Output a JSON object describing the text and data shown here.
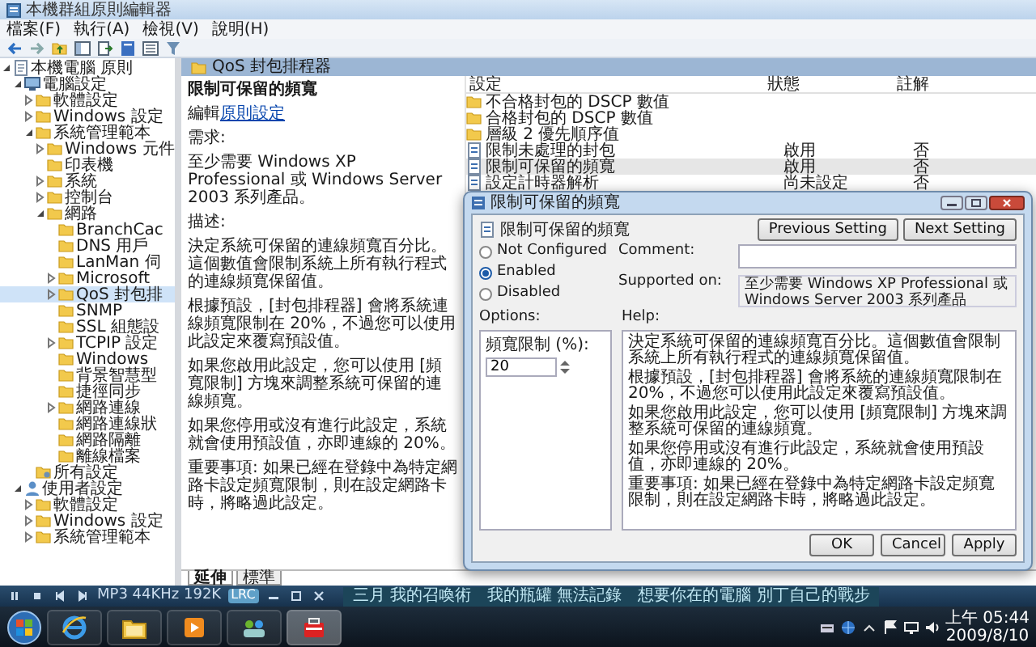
{
  "window": {
    "title": "本機群組原則編輯器"
  },
  "menu": [
    "檔案(F)",
    "執行(A)",
    "檢視(V)",
    "說明(H)"
  ],
  "tree": [
    {
      "label": "本機電腦 原則",
      "kind": "root",
      "expanded": true,
      "selected": false,
      "children": [
        {
          "label": "電腦設定",
          "kind": "computer",
          "expanded": true,
          "selected": false,
          "children": [
            {
              "label": "軟體設定",
              "kind": "folder",
              "expanded": false,
              "selected": false
            },
            {
              "label": "Windows 設定",
              "kind": "folder",
              "expanded": false,
              "selected": false
            },
            {
              "label": "系統管理範本",
              "kind": "folder",
              "expanded": true,
              "selected": false,
              "children": [
                {
                  "label": "Windows 元件",
                  "kind": "folder",
                  "expanded": false,
                  "selected": false
                },
                {
                  "label": "印表機",
                  "kind": "folder",
                  "selected": false
                },
                {
                  "label": "系統",
                  "kind": "folder",
                  "expanded": false,
                  "selected": false
                },
                {
                  "label": "控制台",
                  "kind": "folder",
                  "expanded": false,
                  "selected": false
                },
                {
                  "label": "網路",
                  "kind": "folder",
                  "expanded": true,
                  "selected": false,
                  "children": [
                    {
                      "label": "BranchCac",
                      "kind": "folder",
                      "selected": false
                    },
                    {
                      "label": "DNS 用戶",
                      "kind": "folder",
                      "selected": false
                    },
                    {
                      "label": "LanMan 伺",
                      "kind": "folder",
                      "selected": false
                    },
                    {
                      "label": "Microsoft",
                      "kind": "folder",
                      "expanded": false,
                      "selected": false
                    },
                    {
                      "label": "QoS 封包排",
                      "kind": "folder",
                      "expanded": false,
                      "selected": true
                    },
                    {
                      "label": "SNMP",
                      "kind": "folder",
                      "selected": false
                    },
                    {
                      "label": "SSL 組態設",
                      "kind": "folder",
                      "selected": false
                    },
                    {
                      "label": "TCPIP 設定",
                      "kind": "folder",
                      "expanded": false,
                      "selected": false
                    },
                    {
                      "label": "Windows",
                      "kind": "folder",
                      "selected": false
                    },
                    {
                      "label": "背景智慧型",
                      "kind": "folder",
                      "selected": false
                    },
                    {
                      "label": "捷徑同步",
                      "kind": "folder",
                      "selected": false
                    },
                    {
                      "label": "網路連線",
                      "kind": "folder",
                      "expanded": false,
                      "selected": false
                    },
                    {
                      "label": "網路連線狀",
                      "kind": "folder",
                      "selected": false
                    },
                    {
                      "label": "網路隔離",
                      "kind": "folder",
                      "selected": false
                    },
                    {
                      "label": "離線檔案",
                      "kind": "folder",
                      "selected": false
                    }
                  ]
                }
              ]
            },
            {
              "label": "所有設定",
              "kind": "settings",
              "selected": false
            }
          ]
        },
        {
          "label": "使用者設定",
          "kind": "user",
          "expanded": true,
          "selected": false,
          "children": [
            {
              "label": "軟體設定",
              "kind": "folder",
              "expanded": false,
              "selected": false
            },
            {
              "label": "Windows 設定",
              "kind": "folder",
              "expanded": false,
              "selected": false
            },
            {
              "label": "系統管理範本",
              "kind": "folder",
              "expanded": false,
              "selected": false
            }
          ]
        }
      ]
    }
  ],
  "header": {
    "title": "QoS 封包排程器"
  },
  "description": {
    "title": "限制可保留的頻寬",
    "edit_prefix": "編輯",
    "edit_link": "原則設定",
    "requirements_label": "需求:",
    "requirements": "至少需要 Windows XP Professional 或 Windows Server 2003 系列產品。",
    "description_label": "描述:",
    "paragraphs": [
      "決定系統可保留的連線頻寬百分比。這個數值會限制系統上所有執行程式的連線頻寬保留值。",
      "根據預設，[封包排程器] 會將系統連線頻寬限制在 20%，不過您可以使用此設定來覆寫預設值。",
      "如果您啟用此設定，您可以使用 [頻寬限制] 方塊來調整系統可保留的連線頻寬。",
      "如果您停用或沒有進行此設定，系統就會使用預設值，亦即連線的 20%。",
      "重要事項: 如果已經在登錄中為特定網路卡設定頻寬限制，則在設定網路卡時，將略過此設定。"
    ]
  },
  "list": {
    "columns": [
      "設定",
      "狀態",
      "註解"
    ],
    "rows": [
      {
        "kind": "folder",
        "name": "不合格封包的 DSCP 數值",
        "selected": false
      },
      {
        "kind": "folder",
        "name": "合格封包的 DSCP 數值",
        "selected": false
      },
      {
        "kind": "folder",
        "name": "層級 2 優先順序值",
        "selected": false
      },
      {
        "kind": "policy",
        "name": "限制未處理的封包",
        "state": "啟用",
        "comment": "否",
        "selected": false
      },
      {
        "kind": "policy",
        "name": "限制可保留的頻寬",
        "state": "啟用",
        "comment": "否",
        "selected": true
      },
      {
        "kind": "policy",
        "name": "設定計時器解析",
        "state": "尚未設定",
        "comment": "否",
        "selected": false
      }
    ]
  },
  "dialog": {
    "title": "限制可保留的頻寬",
    "heading": "限制可保留的頻寬",
    "nav_buttons": [
      "Previous Setting",
      "Next Setting"
    ],
    "radios": [
      {
        "label": "Not Configured",
        "selected": false
      },
      {
        "label": "Enabled",
        "selected": true
      },
      {
        "label": "Disabled",
        "selected": false
      }
    ],
    "comment_label": "Comment:",
    "supported_label": "Supported on:",
    "supported_text": "至少需要 Windows XP Professional 或 Windows Server 2003 系列產品",
    "options_label": "Options:",
    "help_label": "Help:",
    "option": {
      "label": "頻寬限制 (%):",
      "value": "20"
    },
    "help": [
      "決定系統可保留的連線頻寬百分比。這個數值會限制系統上所有執行程式的連線頻寬保留值。",
      "根據預設，[封包排程器] 會將系統的連線頻寬限制在 20%，不過您可以使用此設定來覆寫預設值。",
      "如果您啟用此設定，您可以使用 [頻寬限制] 方塊來調整系統可保留的連線頻寬。",
      "如果您停用或沒有進行此設定，系統就會使用預設值，亦即連線的 20%。",
      "重要事項: 如果已經在登錄中為特定網路卡設定頻寬限制，則在設定網路卡時，將略過此設定。"
    ],
    "buttons": [
      "OK",
      "Cancel",
      "Apply"
    ]
  },
  "view_tabs": [
    {
      "label": "延伸",
      "selected": true
    },
    {
      "label": "標準",
      "selected": false
    }
  ],
  "media_bar": {
    "info": "MP3 44KHz 192K",
    "lrc": "LRC",
    "lyrics": "三月 我的召喚術　我的瓶罐 無法記錄　想要你在的電腦 別丁自己的戰步"
  },
  "clock": {
    "time": "上午 05:44",
    "date": "2009/8/10"
  }
}
